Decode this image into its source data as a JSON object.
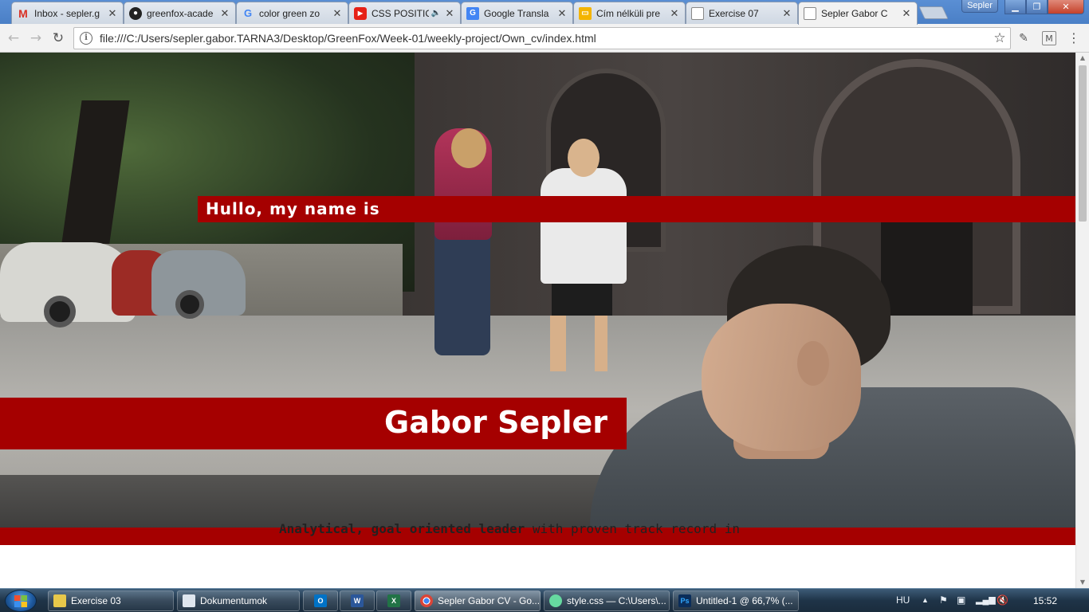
{
  "browser": {
    "tabs": [
      {
        "label": "Inbox - sepler.g",
        "favicon": "gmail-icon",
        "color": "#d93025"
      },
      {
        "label": "greenfox-acade",
        "favicon": "github-icon",
        "color": "#222222"
      },
      {
        "label": "color green zo",
        "favicon": "google-icon",
        "color": "#4285f4"
      },
      {
        "label": "CSS POSITIC",
        "favicon": "youtube-icon",
        "color": "#e62117"
      },
      {
        "label": "Google Transla",
        "favicon": "google-translate-icon",
        "color": "#4285f4"
      },
      {
        "label": "Cím nélküli pre",
        "favicon": "google-slides-icon",
        "color": "#f4b400"
      },
      {
        "label": "Exercise 07",
        "favicon": "page-icon",
        "color": "#888888"
      },
      {
        "label": "Sepler Gabor C",
        "favicon": "page-icon",
        "color": "#888888"
      }
    ],
    "profile_label": "Sepler",
    "url": "file:///C:/Users/sepler.gabor.TARNA3/Desktop/GreenFox/Week-01/weekly-project/Own_cv/index.html"
  },
  "page": {
    "hello_text": "Hullo, my name is",
    "name": "Gabor Sepler",
    "intro_bold": "Analytical, goal oriented leader",
    "intro_rest": " with proven track record in",
    "accent_color": "#a50000"
  },
  "taskbar": {
    "items": [
      {
        "label": "Exercise 03",
        "icon": "folder-icon",
        "color": "#e8c84a"
      },
      {
        "label": "Dokumentumok",
        "icon": "document-icon",
        "color": "#dfe6ee"
      },
      {
        "label": "",
        "icon": "outlook-icon",
        "color": "#0072c6"
      },
      {
        "label": "",
        "icon": "word-icon",
        "color": "#2b579a"
      },
      {
        "label": "",
        "icon": "excel-icon",
        "color": "#217346"
      },
      {
        "label": "Sepler Gabor CV - Go...",
        "icon": "chrome-icon",
        "color": "#4285f4"
      },
      {
        "label": "style.css — C:\\Users\\...",
        "icon": "atom-icon",
        "color": "#66d9a0"
      },
      {
        "label": "Untitled-1 @ 66,7% (...",
        "icon": "photoshop-icon",
        "color": "#0a2d5a"
      }
    ],
    "language": "HU",
    "clock": "15:52"
  }
}
